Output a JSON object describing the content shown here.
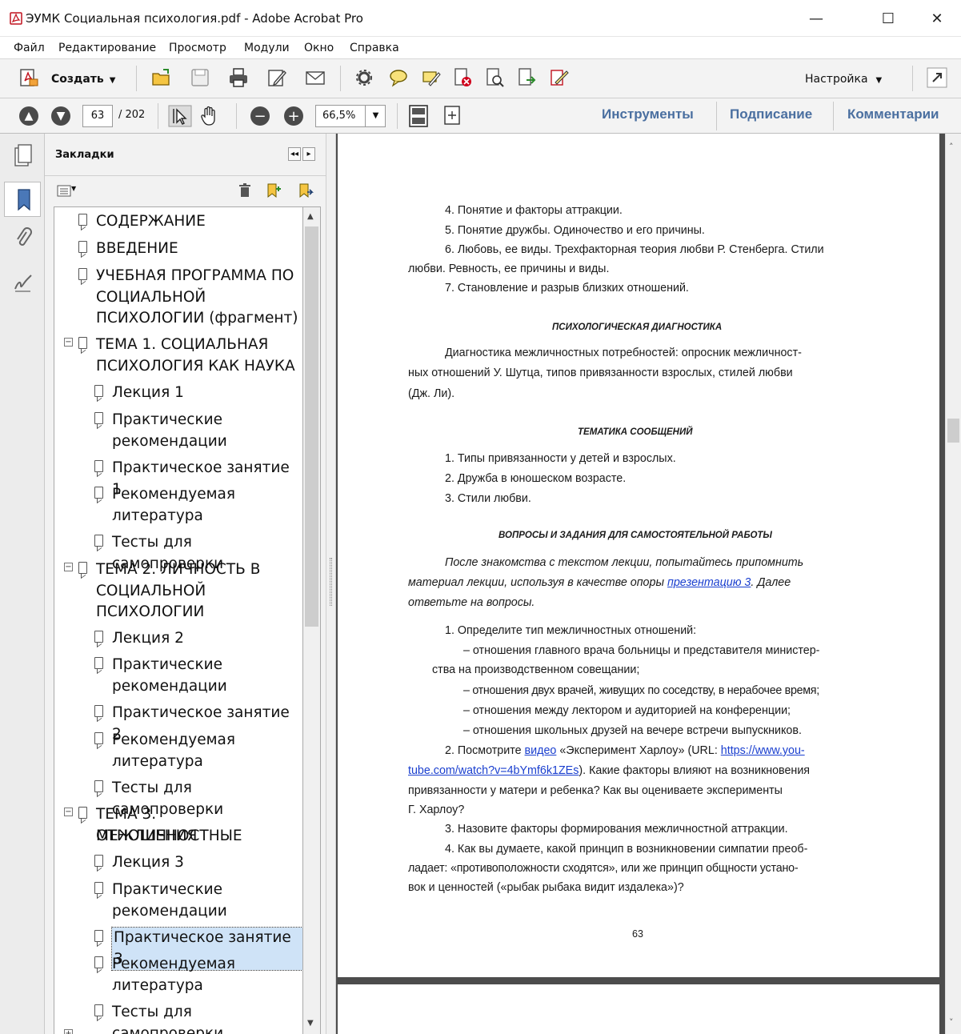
{
  "window": {
    "title": "ЭУМК Социальная психология.pdf - Adobe Acrobat Pro",
    "minimize": "—",
    "maximize": "☐",
    "close": "✕"
  },
  "menu": [
    "Файл",
    "Редактирование",
    "Просмотр",
    "Модули",
    "Окно",
    "Справка"
  ],
  "toolbar": {
    "create_label": "Создать",
    "customize_label": "Настройка",
    "page_current": "63",
    "page_total": "/ 202",
    "zoom": "66,5%",
    "tools_label": "Инструменты",
    "sign_label": "Подписание",
    "comments_label": "Комментарии"
  },
  "bookmarks": {
    "title": "Закладки",
    "items": [
      {
        "lines": [
          "СОДЕРЖАНИЕ"
        ]
      },
      {
        "lines": [
          "ВВЕДЕНИЕ"
        ]
      },
      {
        "lines": [
          "УЧЕБНАЯ ПРОГРАММА ПО",
          "СОЦИАЛЬНОЙ",
          "ПСИХОЛОГИИ  (фрагмент)"
        ]
      },
      {
        "lines": [
          "ТЕМА 1. СОЦИАЛЬНАЯ",
          "ПСИХОЛОГИЯ КАК НАУКА"
        ]
      },
      {
        "lines": [
          "Лекция 1"
        ]
      },
      {
        "lines": [
          "Практические",
          "рекомендации"
        ]
      },
      {
        "lines": [
          "Практическое занятие 1"
        ]
      },
      {
        "lines": [
          "Рекомендуемая",
          "литература"
        ]
      },
      {
        "lines": [
          "Тесты для самопроверки"
        ]
      },
      {
        "lines": [
          "ТЕМА 2. ЛИЧНОСТЬ В",
          "СОЦИАЛЬНОЙ",
          "ПСИХОЛОГИИ"
        ]
      },
      {
        "lines": [
          "Лекция 2"
        ]
      },
      {
        "lines": [
          "Практические",
          "рекомендации"
        ]
      },
      {
        "lines": [
          "Практическое занятие 2"
        ]
      },
      {
        "lines": [
          "Рекомендуемая",
          "литература"
        ]
      },
      {
        "lines": [
          "Тесты для самопроверки"
        ]
      },
      {
        "lines": [
          "ТЕМА 3. МЕЖЛИЧНОСТНЫЕ",
          "ОТНОШЕНИЯ"
        ]
      },
      {
        "lines": [
          "Лекция 3"
        ]
      },
      {
        "lines": [
          "Практические",
          "рекомендации"
        ]
      },
      {
        "lines": [
          "Практическое занятие 3"
        ]
      },
      {
        "lines": [
          "Рекомендуемая",
          "литература"
        ]
      },
      {
        "lines": [
          "Тесты для самопроверки"
        ]
      }
    ]
  },
  "document": {
    "list1": [
      "4.  Понятие и факторы аттракции.",
      "5.  Понятие дружбы. Одиночество и его причины.",
      "6.  Любовь, ее виды. Трехфакторная теория любви Р. Стенберга. Стили",
      "любви. Ревность, ее причины и виды.",
      "7.  Становление и разрыв близких отношений."
    ],
    "heading_diag": "ПСИХОЛОГИЧЕСКАЯ ДИАГНОСТИКА",
    "diag_lines": [
      "Диагностика межличностных потребностей: опросник межличност-",
      "ных отношений У. Шутца, типов привязанности взрослых, стилей любви",
      "(Дж. Ли)."
    ],
    "heading_topics": "ТЕМАТИКА СООБЩЕНИЙ",
    "topics": [
      "1.  Типы привязанности у детей и взрослых.",
      "2.  Дружба в юношеском возрасте.",
      "3.  Стили любви."
    ],
    "heading_tasks": "ВОПРОСЫ И ЗАДАНИЯ ДЛЯ САМОСТОЯТЕЛЬНОЙ РАБОТЫ",
    "intro_line1": "После знакомства с текстом лекции, попытайтесь припомнить",
    "intro_line2a": "материал лекции, используя в качестве опоры",
    "intro_link": "презентацию 3",
    "intro_line2b": ". Далее",
    "intro_line3": "ответьте на вопросы.",
    "q1": "1.  Определите тип межличностных отношений:",
    "q1_items": [
      "– отношения главного врача больницы и представителя министер-",
      "ства на производственном совещании;",
      "– отношения двух врачей, живущих по соседству, в нерабочее время;",
      "– отношения между лектором и аудиторией на конференции;",
      "– отношения школьных друзей на вечере встречи выпускников."
    ],
    "q2_a": "2.  Посмотрите",
    "q2_link": "видео",
    "q2_b": "«Эксперимент Харлоу» (URL:",
    "q2_url1": "https://www.you-",
    "q2_url2": "tube.com/watch?v=4bYmf6k1ZEs",
    "q2_c": "). Какие факторы влияют на возникновения",
    "q2_d": "привязанности у матери и ребенка? Как вы оцениваете эксперименты",
    "q2_e": "Г. Харлоу?",
    "q3": "3.  Назовите факторы формирования межличностной аттракции.",
    "q4_lines": [
      "4.  Как вы думаете, какой принцип в возникновении симпатии преоб-",
      "ладает: «противоположности сходятся», или же принцип общности устано-",
      "вок и ценностей («рыбак рыбака видит издалека»)?"
    ],
    "page_number": "63"
  },
  "colors": {
    "accent_link": "#1a3fcf",
    "panel_button": "#4a6fa0",
    "selection": "#cfe3f7"
  }
}
